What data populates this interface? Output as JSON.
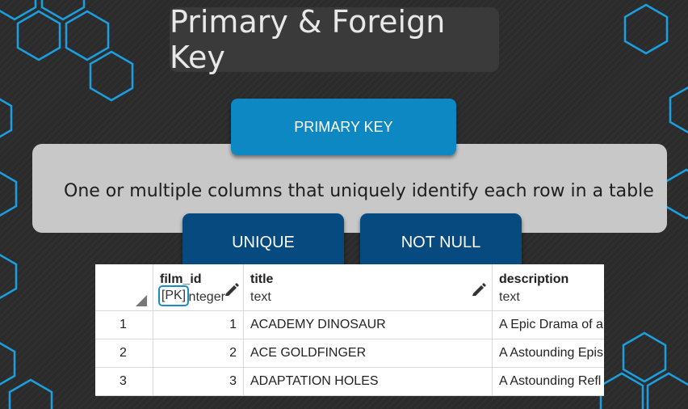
{
  "slide": {
    "title": "Primary & Foreign Key",
    "primary_key_label": "PRIMARY KEY",
    "description": "One or multiple columns that uniquely identify each row in a table",
    "constraints": [
      "UNIQUE",
      "NOT NULL"
    ]
  },
  "table": {
    "columns": [
      {
        "name": "film_id",
        "type": "integer",
        "badge": "[PK]"
      },
      {
        "name": "title",
        "type": "text"
      },
      {
        "name": "description",
        "type": "text"
      }
    ],
    "rows": [
      {
        "row": "1",
        "film_id": "1",
        "title": "ACADEMY DINOSAUR",
        "description": "A Epic Drama of a"
      },
      {
        "row": "2",
        "film_id": "2",
        "title": "ACE GOLDFINGER",
        "description": "A Astounding Epis"
      },
      {
        "row": "3",
        "film_id": "3",
        "title": "ADAPTATION HOLES",
        "description": "A Astounding Refl"
      }
    ]
  },
  "colors": {
    "primary_key_button": "#0d88c2",
    "constraint_pill": "#064a80",
    "hexagon_outline": "#1b9fe0",
    "background": "#2b2b2b"
  }
}
